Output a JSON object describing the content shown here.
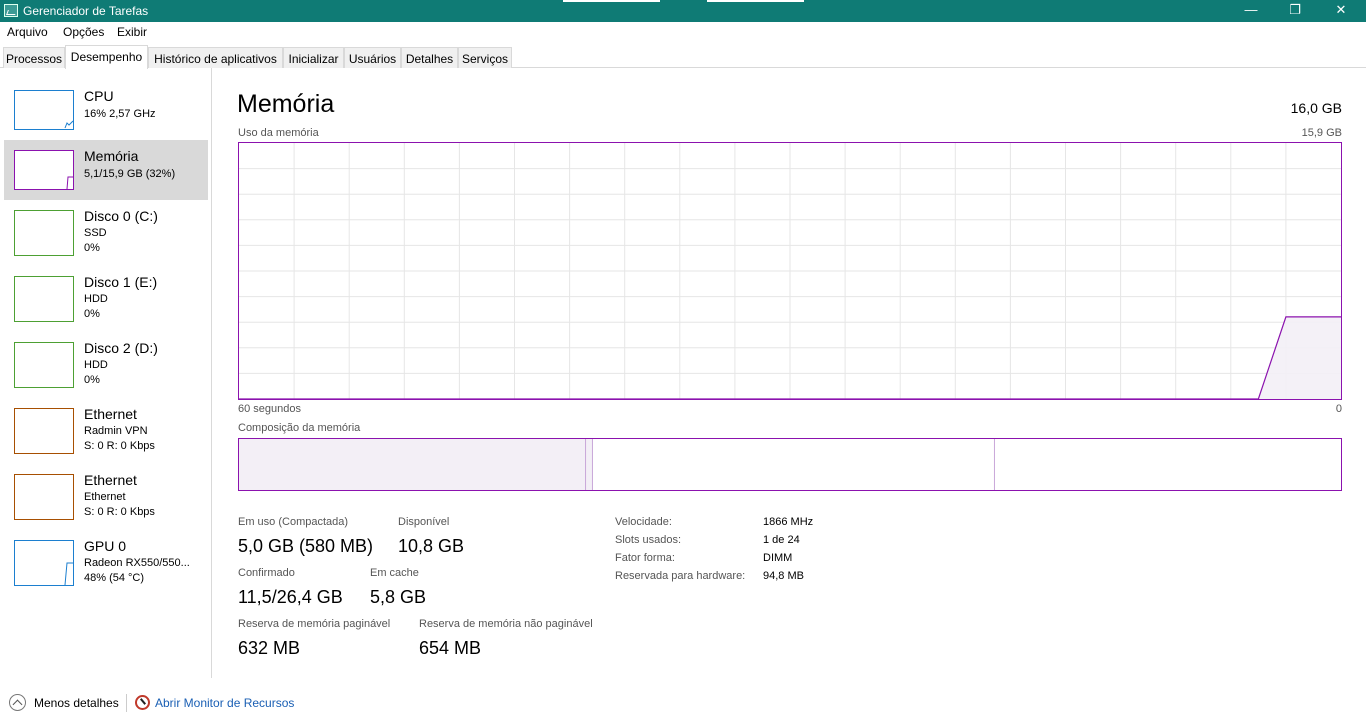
{
  "window": {
    "title": "Gerenciador de Tarefas",
    "buttons": {
      "minimize": "—",
      "maximize": "❐",
      "close": "✕"
    }
  },
  "menu": [
    "Arquivo",
    "Opções",
    "Exibir"
  ],
  "tabs": [
    "Processos",
    "Desempenho",
    "Histórico de aplicativos",
    "Inicializar",
    "Usuários",
    "Detalhes",
    "Serviços"
  ],
  "active_tab": "Desempenho",
  "sidebar": [
    {
      "name": "CPU",
      "line1": "16% 2,57 GHz",
      "line2": "",
      "color": "#1c7fcf",
      "usage": 0.16
    },
    {
      "name": "Memória",
      "line1": "5,1/15,9 GB (32%)",
      "line2": "",
      "color": "#8b12ae",
      "usage": 0.32
    },
    {
      "name": "Disco 0 (C:)",
      "line1": "SSD",
      "line2": "0%",
      "color": "#4da033",
      "usage": 0
    },
    {
      "name": "Disco 1 (E:)",
      "line1": "HDD",
      "line2": "0%",
      "color": "#4da033",
      "usage": 0
    },
    {
      "name": "Disco 2 (D:)",
      "line1": "HDD",
      "line2": "0%",
      "color": "#4da033",
      "usage": 0
    },
    {
      "name": "Ethernet",
      "line1": "Radmin VPN",
      "line2": "S: 0 R: 0 Kbps",
      "color": "#a74f01",
      "usage": 0
    },
    {
      "name": "Ethernet",
      "line1": "Ethernet",
      "line2": "S: 0 R: 0 Kbps",
      "color": "#a74f01",
      "usage": 0
    },
    {
      "name": "GPU 0",
      "line1": "Radeon RX550/550...",
      "line2": "48% (54 °C)",
      "color": "#1c7fcf",
      "usage": 0.48
    }
  ],
  "main": {
    "title": "Memória",
    "total": "16,0 GB",
    "usage_label": "Uso da memória",
    "usage_max": "15,9 GB",
    "time_label": "60 segundos",
    "time_end": "0",
    "composition_label": "Composição da memória",
    "stats": [
      {
        "label": "Em uso (Compactada)",
        "value": "5,0 GB (580 MB)"
      },
      {
        "label": "Disponível",
        "value": "10,8 GB"
      },
      {
        "label": "Confirmado",
        "value": "11,5/26,4 GB"
      },
      {
        "label": "Em cache",
        "value": "5,8 GB"
      },
      {
        "label": "Reserva de memória paginável",
        "value": "632 MB"
      },
      {
        "label": "Reserva de memória não paginável",
        "value": "654 MB"
      }
    ],
    "specs": [
      {
        "label": "Velocidade:",
        "value": "1866 MHz"
      },
      {
        "label": "Slots usados:",
        "value": "1 de 24"
      },
      {
        "label": "Fator forma:",
        "value": "DIMM"
      },
      {
        "label": "Reservada para hardware:",
        "value": "94,8 MB"
      }
    ]
  },
  "chart_data": {
    "type": "area",
    "title": "Uso da memória",
    "xlabel": "60 segundos",
    "x_range": [
      60,
      0
    ],
    "ylim": [
      0,
      15.9
    ],
    "unit": "GB",
    "grid": true,
    "color": "#8b12ae",
    "fill": "#f3eff6",
    "series": [
      {
        "points": [
          [
            60,
            0
          ],
          [
            4.5,
            0
          ],
          [
            3.0,
            5.1
          ],
          [
            0,
            5.1
          ]
        ]
      }
    ],
    "composition": {
      "in_use_gb": 5.0,
      "modified_gb": 0.1,
      "standby_gb": 5.8,
      "free_gb": 5.0
    }
  },
  "footer": {
    "less_details": "Menos detalhes",
    "resource_monitor": "Abrir Monitor de Recursos"
  }
}
